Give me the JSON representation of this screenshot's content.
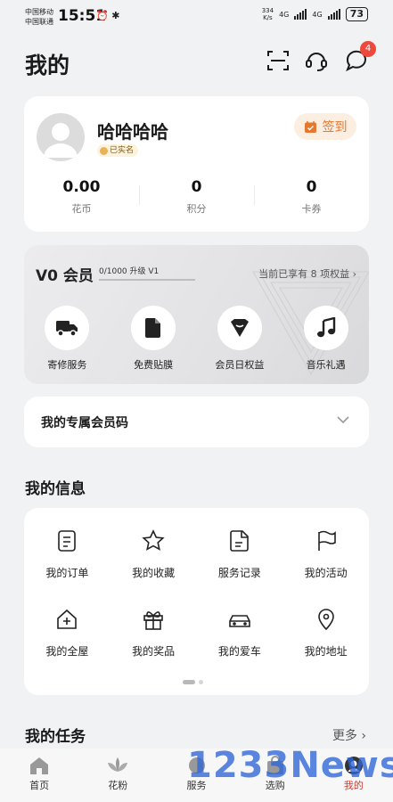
{
  "status_bar": {
    "carrier_1": "中国移动",
    "carrier_2": "中国联通",
    "time": "15:51",
    "net_speed_value": "334",
    "net_speed_unit": "K/s",
    "network_1": "4G",
    "network_2": "4G",
    "battery": "73"
  },
  "header": {
    "title": "我的",
    "message_badge": "4",
    "icons": [
      "scan-icon",
      "headset-icon",
      "message-icon"
    ]
  },
  "profile": {
    "username": "哈哈哈哈",
    "verified_label": "已实名",
    "checkin_label": "签到",
    "stats": [
      {
        "value": "0.00",
        "label": "花币"
      },
      {
        "value": "0",
        "label": "积分"
      },
      {
        "value": "0",
        "label": "卡券"
      }
    ]
  },
  "membership": {
    "level": "V0 会员",
    "progress_text": "0/1000 升级 V1",
    "progress_fraction": 0,
    "benefits_link": "当前已享有 8 项权益",
    "perks": [
      {
        "label": "寄修服务",
        "icon": "truck-icon"
      },
      {
        "label": "免费贴膜",
        "icon": "phone-film-icon"
      },
      {
        "label": "会员日权益",
        "icon": "gift-heart-icon"
      },
      {
        "label": "音乐礼遇",
        "icon": "music-note-icon"
      }
    ]
  },
  "member_code": {
    "label": "我的专属会员码"
  },
  "my_info": {
    "title": "我的信息",
    "items": [
      {
        "label": "我的订单",
        "icon": "order-icon"
      },
      {
        "label": "我的收藏",
        "icon": "star-icon"
      },
      {
        "label": "服务记录",
        "icon": "document-icon"
      },
      {
        "label": "我的活动",
        "icon": "flag-icon"
      },
      {
        "label": "我的全屋",
        "icon": "house-icon"
      },
      {
        "label": "我的奖品",
        "icon": "gift-icon"
      },
      {
        "label": "我的爱车",
        "icon": "car-icon"
      },
      {
        "label": "我的地址",
        "icon": "location-icon"
      }
    ]
  },
  "tasks": {
    "title": "我的任务",
    "more_label": "更多"
  },
  "tab_bar": {
    "items": [
      {
        "label": "首页",
        "icon": "home-icon"
      },
      {
        "label": "花粉",
        "icon": "flower-icon"
      },
      {
        "label": "服务",
        "icon": "service-icon"
      },
      {
        "label": "选购",
        "icon": "shop-icon"
      },
      {
        "label": "我的",
        "icon": "profile-icon",
        "active": true
      }
    ]
  },
  "watermark": "1233News",
  "colors": {
    "accent_red": "#d23a2f",
    "checkin_orange": "#e3782e",
    "badge_red": "#ee4a3c",
    "watermark_blue": "#2f66d8"
  }
}
